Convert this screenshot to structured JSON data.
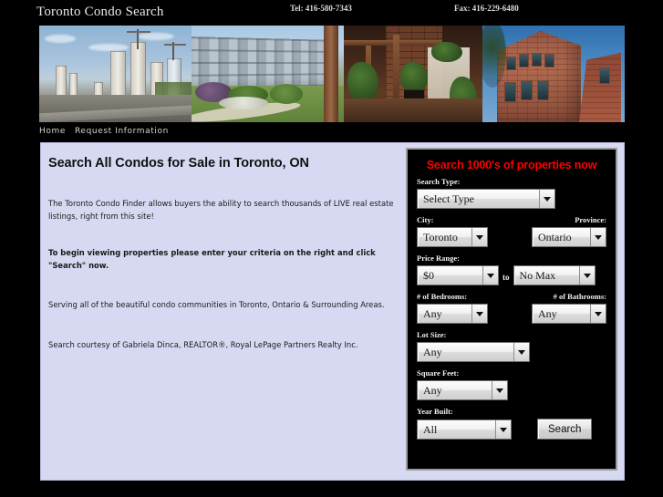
{
  "header": {
    "site_title": "Toronto Condo Search",
    "tel": "Tel: 416-580-7343",
    "fax": "Fax: 416-229-6480"
  },
  "nav": {
    "items": [
      {
        "label": "Home"
      },
      {
        "label": "Request Information"
      }
    ]
  },
  "banner": {
    "panels": [
      {
        "alt": "downtown-condo-towers-under-construction"
      },
      {
        "alt": "low-rise-condo-building-with-garden"
      },
      {
        "alt": "courtyard-patio-with-plants"
      },
      {
        "alt": "red-brick-loft-building"
      }
    ]
  },
  "main": {
    "heading": "Search All Condos for Sale in Toronto, ON",
    "paragraph_intro": "The Toronto Condo Finder allows buyers the ability to search thousands of LIVE real estate listings, right from this site!",
    "paragraph_begin": "To begin viewing properties please enter your criteria on the right and click \"Search\" now.",
    "paragraph_serving": "Serving all of the beautiful condo communities in Toronto, Ontario & Surrounding Areas.",
    "paragraph_courtesy": "Search courtesy of Gabriela Dinca, REALTOR®, Royal LePage Partners Realty Inc."
  },
  "search_panel": {
    "title": "Search 1000's of properties now",
    "accent_color": "#ff0000",
    "fields": {
      "search_type": {
        "label": "Search Type:",
        "value": "Select Type"
      },
      "city": {
        "label": "City:",
        "value": "Toronto"
      },
      "province": {
        "label": "Province:",
        "value": "Ontario"
      },
      "price_range": {
        "label": "Price Range:",
        "min_value": "$0",
        "separator": "to",
        "max_value": "No Max"
      },
      "bedrooms": {
        "label": "# of Bedrooms:",
        "value": "Any"
      },
      "bathrooms": {
        "label": "# of Bathrooms:",
        "value": "Any"
      },
      "lot_size": {
        "label": "Lot Size:",
        "value": "Any"
      },
      "square_feet": {
        "label": "Square Feet:",
        "value": "Any"
      },
      "year_built": {
        "label": "Year Built:",
        "value": "All"
      }
    },
    "search_button": "Search"
  }
}
